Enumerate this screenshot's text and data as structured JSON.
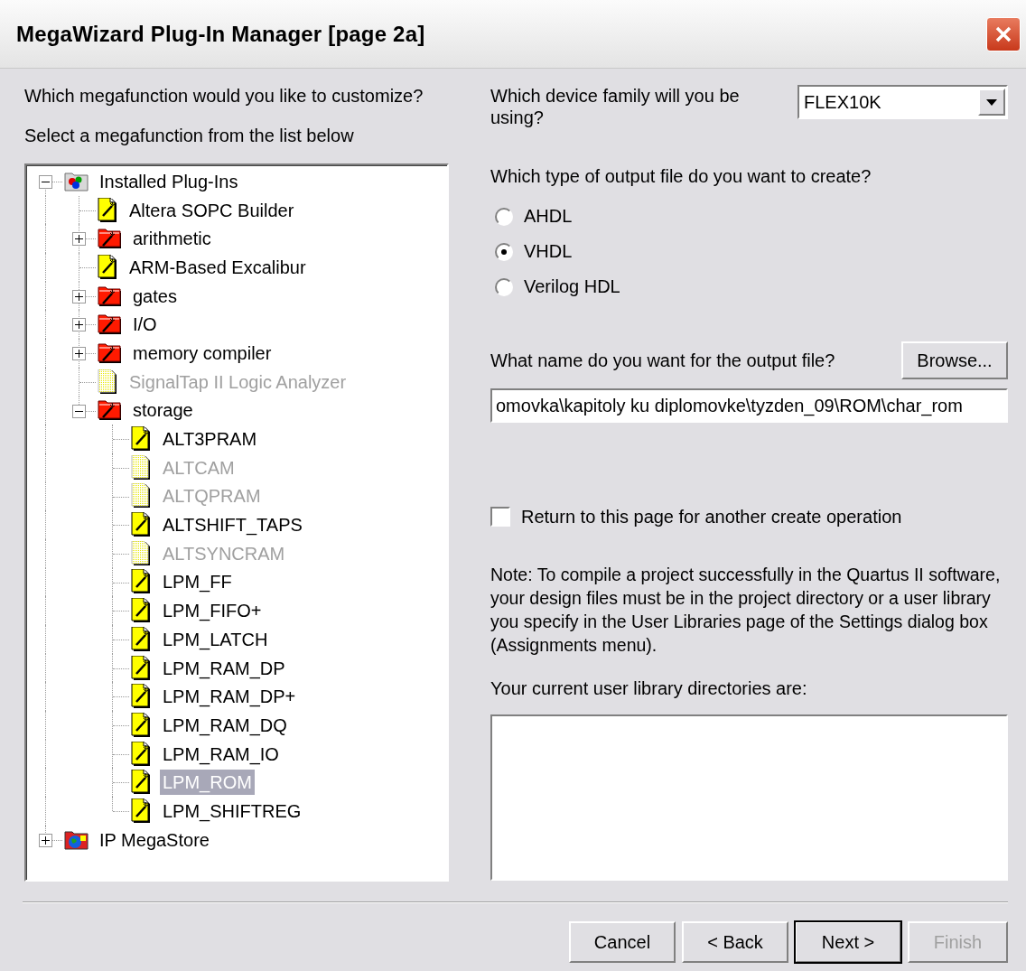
{
  "window": {
    "title": "MegaWizard Plug-In Manager [page 2a]"
  },
  "prompt": "Which megafunction would you like to customize?",
  "list_hint": "Select a megafunction from the list below",
  "tree": [
    {
      "label": "Installed Plug-Ins",
      "kind": "plugins",
      "expanded": true,
      "disabled": false,
      "selected": false,
      "children": [
        {
          "label": "Altera SOPC Builder",
          "kind": "wizard",
          "disabled": false,
          "selected": false
        },
        {
          "label": "arithmetic",
          "kind": "folder",
          "expanded": false,
          "disabled": false,
          "selected": false
        },
        {
          "label": "ARM-Based Excalibur",
          "kind": "wizard",
          "disabled": false,
          "selected": false
        },
        {
          "label": "gates",
          "kind": "folder",
          "expanded": false,
          "disabled": false,
          "selected": false
        },
        {
          "label": "I/O",
          "kind": "folder",
          "expanded": false,
          "disabled": false,
          "selected": false
        },
        {
          "label": "memory compiler",
          "kind": "folder",
          "expanded": false,
          "disabled": false,
          "selected": false
        },
        {
          "label": "SignalTap II Logic Analyzer",
          "kind": "wizard",
          "disabled": true,
          "selected": false
        },
        {
          "label": "storage",
          "kind": "folder",
          "expanded": true,
          "disabled": false,
          "selected": false,
          "children": [
            {
              "label": "ALT3PRAM",
              "kind": "wizard",
              "disabled": false,
              "selected": false
            },
            {
              "label": "ALTCAM",
              "kind": "wizard",
              "disabled": true,
              "selected": false
            },
            {
              "label": "ALTQPRAM",
              "kind": "wizard",
              "disabled": true,
              "selected": false
            },
            {
              "label": "ALTSHIFT_TAPS",
              "kind": "wizard",
              "disabled": false,
              "selected": false
            },
            {
              "label": "ALTSYNCRAM",
              "kind": "wizard",
              "disabled": true,
              "selected": false
            },
            {
              "label": "LPM_FF",
              "kind": "wizard",
              "disabled": false,
              "selected": false
            },
            {
              "label": "LPM_FIFO+",
              "kind": "wizard",
              "disabled": false,
              "selected": false
            },
            {
              "label": "LPM_LATCH",
              "kind": "wizard",
              "disabled": false,
              "selected": false
            },
            {
              "label": "LPM_RAM_DP",
              "kind": "wizard",
              "disabled": false,
              "selected": false
            },
            {
              "label": "LPM_RAM_DP+",
              "kind": "wizard",
              "disabled": false,
              "selected": false
            },
            {
              "label": "LPM_RAM_DQ",
              "kind": "wizard",
              "disabled": false,
              "selected": false
            },
            {
              "label": "LPM_RAM_IO",
              "kind": "wizard",
              "disabled": false,
              "selected": false
            },
            {
              "label": "LPM_ROM",
              "kind": "wizard",
              "disabled": false,
              "selected": true
            },
            {
              "label": "LPM_SHIFTREG",
              "kind": "wizard",
              "disabled": false,
              "selected": false
            }
          ]
        }
      ]
    },
    {
      "label": "IP MegaStore",
      "kind": "store",
      "expanded": false,
      "disabled": false,
      "selected": false
    }
  ],
  "device_family": {
    "label": "Which device family will you be using?",
    "value": "FLEX10K"
  },
  "output_type": {
    "label": "Which type of output file do you want to create?",
    "options": [
      {
        "label": "AHDL",
        "selected": false
      },
      {
        "label": "VHDL",
        "selected": true
      },
      {
        "label": "Verilog HDL",
        "selected": false
      }
    ]
  },
  "output_file": {
    "label": "What name do you want for the output file?",
    "browse_button": "Browse...",
    "value": "omovka\\kapitoly ku diplomovke\\tyzden_09\\ROM\\char_rom"
  },
  "return_checkbox": {
    "label": "Return to this page for another create operation",
    "checked": false
  },
  "note": "Note: To compile a project successfully in the Quartus II software, your design files must be in the project directory or a user library you specify in the User Libraries page of the Settings dialog box (Assignments menu).",
  "library": {
    "label": "Your current user library directories are:"
  },
  "buttons": [
    {
      "label": "Cancel",
      "disabled": false,
      "default": false
    },
    {
      "label": "< Back",
      "disabled": false,
      "default": false
    },
    {
      "label": "Next >",
      "disabled": false,
      "default": true
    },
    {
      "label": "Finish",
      "disabled": true,
      "default": false
    }
  ]
}
